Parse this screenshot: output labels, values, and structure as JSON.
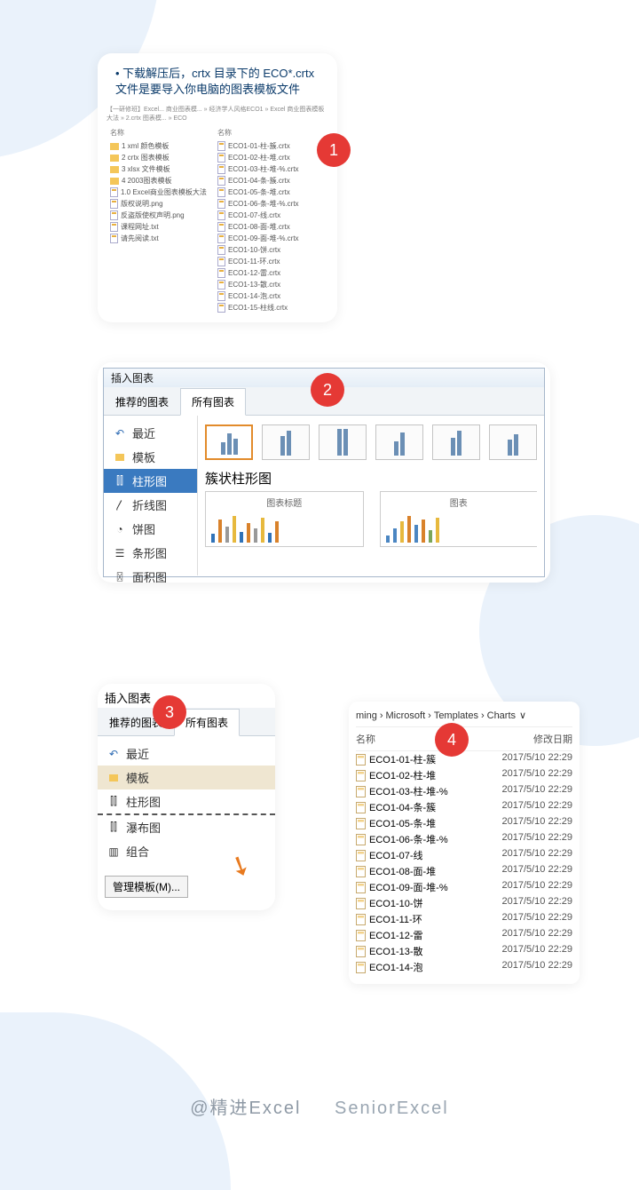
{
  "steps": {
    "s1": "1",
    "s2": "2",
    "s3": "3",
    "s4": "4"
  },
  "bullet_text": "下载解压后，crtx 目录下的 ECO*.crtx 文件是要导入你电脑的图表模板文件",
  "s1_breadcrumb": "【一研修班】Excel... 商业图表模... » 经济学人风格ECO1 » Excel 商业图表模板大法 » 2.crtx 图表模... » ECO",
  "s1_left_header": "名称",
  "s1_left_items": [
    "1 xml 颜色模板",
    "2 crtx 图表模板",
    "3 xlsx 文件模板",
    "4 2003图表模板",
    "1.0 Excel商业图表模板大法",
    "版权说明.png",
    "反盗版使权声明.png",
    "课程网址.txt",
    "请先阅读.txt"
  ],
  "s1_right_header": "名称",
  "s1_right_items": [
    "ECO1-01-柱-簇.crtx",
    "ECO1-02-柱-堆.crtx",
    "ECO1-03-柱-堆-%.crtx",
    "ECO1-04-条-簇.crtx",
    "ECO1-05-条-堆.crtx",
    "ECO1-06-条-堆-%.crtx",
    "ECO1-07-线.crtx",
    "ECO1-08-面-堆.crtx",
    "ECO1-09-面-堆-%.crtx",
    "ECO1-10-饼.crtx",
    "ECO1-11-环.crtx",
    "ECO1-12-雷.crtx",
    "ECO1-13-散.crtx",
    "ECO1-14-泡.crtx",
    "ECO1-15-柱线.crtx"
  ],
  "dlg": {
    "title": "插入图表",
    "tab_rec": "推荐的图表",
    "tab_all": "所有图表",
    "cats": {
      "recent": "最近",
      "template": "模板",
      "column": "柱形图",
      "line": "折线图",
      "pie": "饼图",
      "bar": "条形图",
      "area": "面积图",
      "waterfall": "瀑布图",
      "combo": "组合"
    },
    "preview_title": "簇状柱形图",
    "chart_label": "图表标题",
    "chart_label2": "图表"
  },
  "s3_title": "插入图表",
  "s3_button": "管理模板(M)...",
  "explorer": {
    "crumbs": [
      "ming",
      "Microsoft",
      "Templates",
      "Charts"
    ],
    "col_name": "名称",
    "col_date": "修改日期",
    "date": "2017/5/10 22:29",
    "rows": [
      "ECO1-01-柱-簇",
      "ECO1-02-柱-堆",
      "ECO1-03-柱-堆-%",
      "ECO1-04-条-簇",
      "ECO1-05-条-堆",
      "ECO1-06-条-堆-%",
      "ECO1-07-线",
      "ECO1-08-面-堆",
      "ECO1-09-面-堆-%",
      "ECO1-10-饼",
      "ECO1-11-环",
      "ECO1-12-雷",
      "ECO1-13-散",
      "ECO1-14-泡"
    ]
  },
  "footer_cn": "@精进Excel",
  "footer_en": "SeniorExcel"
}
